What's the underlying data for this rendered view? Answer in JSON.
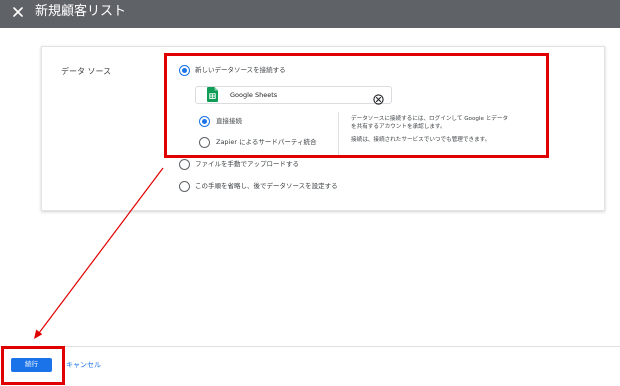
{
  "dialog": {
    "title": "新規顧客リスト"
  },
  "data_source": {
    "section_label": "データ ソース",
    "options": [
      {
        "label": "新しいデータソースを接続する",
        "selected": true
      },
      {
        "label": "ファイルを手動でアップロードする",
        "selected": false
      },
      {
        "label": "この手順を省略し、後でデータソースを設定する",
        "selected": false
      }
    ],
    "connector": {
      "name": "Google Sheets",
      "icon": "google-sheets-icon",
      "clear_icon": "clear-icon"
    },
    "connection_methods": [
      {
        "label": "直接接続",
        "selected": true
      },
      {
        "label": "Zapier によるサードパーティ統合",
        "selected": false
      }
    ],
    "info_lines": [
      "データソースに接続するには、ログインして Google とデータ",
      "を共有するアカウントを承認します。",
      "接続は、接続されたサービスでいつでも管理できます。"
    ]
  },
  "footer": {
    "continue_label": "続行",
    "cancel_label": "キャンセル"
  },
  "colors": {
    "titlebar": "#5f6368",
    "accent": "#1a73e8",
    "annotation": "#e00000",
    "sheets_green": "#0f9d58"
  }
}
